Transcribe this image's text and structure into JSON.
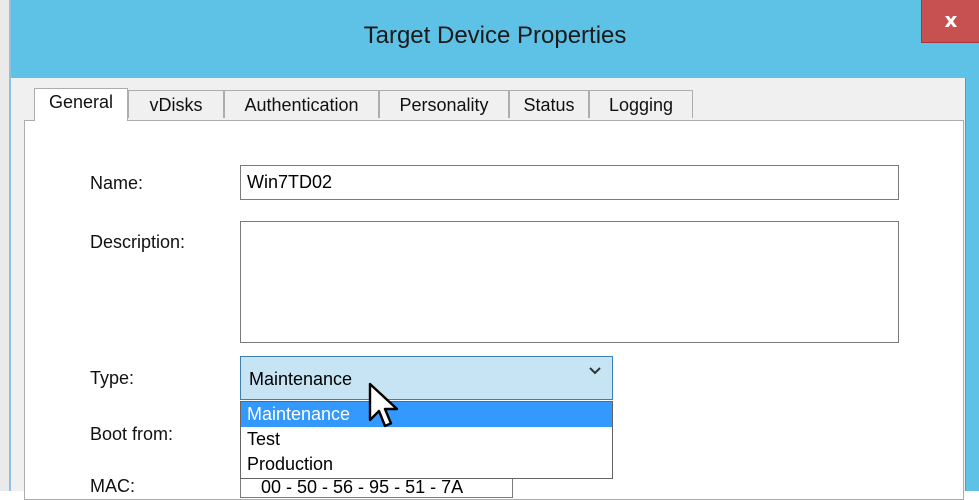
{
  "window": {
    "title": "Target Device Properties",
    "close_glyph": "x",
    "accent_color": "#5ec1e6",
    "close_color": "#c75050"
  },
  "tabs": [
    {
      "label": "General",
      "selected": true
    },
    {
      "label": "vDisks"
    },
    {
      "label": "Authentication"
    },
    {
      "label": "Personality"
    },
    {
      "label": "Status"
    },
    {
      "label": "Logging"
    }
  ],
  "form": {
    "name_label": "Name:",
    "name_value": "Win7TD02",
    "description_label": "Description:",
    "description_value": "",
    "type_label": "Type:",
    "type_value": "Maintenance",
    "type_options": [
      "Maintenance",
      "Test",
      "Production"
    ],
    "type_highlighted": "Maintenance",
    "boot_label": "Boot from:",
    "mac_label": "MAC:",
    "mac_value": "00 - 50 - 56 - 95 - 51 - 7A"
  },
  "icons": {
    "combo_arrow": "chevron-down-icon",
    "cursor": "mouse-pointer-icon"
  }
}
